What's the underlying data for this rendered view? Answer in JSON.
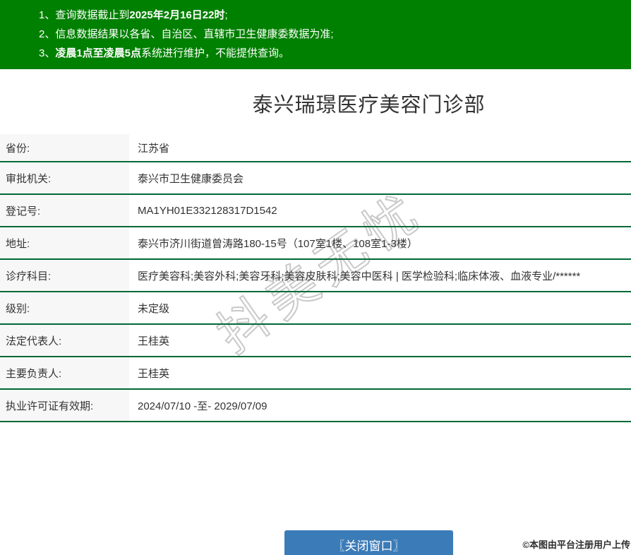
{
  "colors": {
    "banner_green": "#008000",
    "row_border_green": "#006838",
    "label_cell_bg": "#f7f7f7",
    "button_blue": "#3b7cb8",
    "text": "#333333",
    "watermark_outline": "#c9c9c9"
  },
  "banner": {
    "notices": [
      {
        "num": "1、",
        "pre": "查询数据截止到",
        "bold": "2025年2月16日22时",
        "post": ";"
      },
      {
        "num": "2、",
        "pre": "信息数据结果以各省、自治区、直辖市卫生健康委数据为准;",
        "bold": "",
        "post": ""
      },
      {
        "num": "3、",
        "pre": "",
        "bold": "凌晨1点至凌晨5点",
        "post": "系统进行维护，不能提供查询。"
      }
    ]
  },
  "page": {
    "title": "泰兴瑞璟医疗美容门诊部"
  },
  "details": {
    "rows": [
      {
        "label": "省份:",
        "value": "江苏省"
      },
      {
        "label": "审批机关:",
        "value": "泰兴市卫生健康委员会"
      },
      {
        "label": "登记号:",
        "value": "MA1YH01E332128317D1542"
      },
      {
        "label": "地址:",
        "value": "泰兴市济川街道曾涛路180-15号（107室1楼、108室1-3楼）"
      },
      {
        "label": "诊疗科目:",
        "value": "医疗美容科;美容外科;美容牙科;美容皮肤科;美容中医科 | 医学检验科;临床体液、血液专业/******"
      },
      {
        "label": "级别:",
        "value": "未定级"
      },
      {
        "label": "法定代表人:",
        "value": "王桂英"
      },
      {
        "label": "主要负责人:",
        "value": "王桂英"
      },
      {
        "label": "执业许可证有效期:",
        "value": "2024/07/10 -至- 2029/07/09"
      }
    ]
  },
  "watermark": {
    "text": "抖美无忧"
  },
  "footer": {
    "close_button_label": "〖关闭窗口〗",
    "copyright": "©本图由平台注册用户上传"
  }
}
